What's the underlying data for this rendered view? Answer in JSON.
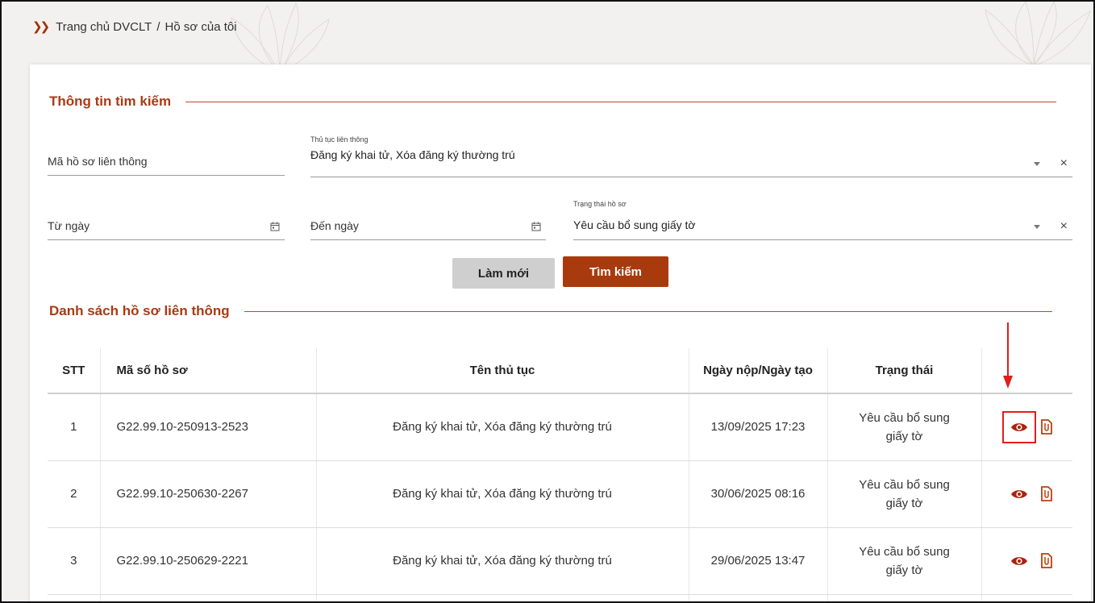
{
  "breadcrumb": {
    "home": "Trang chủ DVCLT",
    "separator": "/",
    "current": "Hồ sơ của tôi"
  },
  "search": {
    "title": "Thông tin tìm kiếm",
    "ma_ho_so": {
      "placeholder": "Mã hồ sơ liên thông"
    },
    "thu_tuc": {
      "label": "Thủ tục liên thông",
      "value": "Đăng ký khai tử, Xóa đăng ký thường trú"
    },
    "tu_ngay": {
      "placeholder": "Từ ngày"
    },
    "den_ngay": {
      "placeholder": "Đến ngày"
    },
    "trang_thai": {
      "label": "Trạng thái hồ sơ",
      "value": "Yêu cầu bổ sung giấy tờ"
    },
    "clear_symbol": "×",
    "reset_label": "Làm mới",
    "search_label": "Tìm kiếm"
  },
  "list": {
    "title": "Danh sách hồ sơ liên thông",
    "headers": {
      "stt": "STT",
      "ma": "Mã số hồ sơ",
      "ten": "Tên thủ tục",
      "ngay": "Ngày nộp/Ngày tạo",
      "trang_thai": "Trạng thái"
    },
    "rows": [
      {
        "stt": "1",
        "ma": "G22.99.10-250913-2523",
        "ten": "Đăng ký khai tử, Xóa đăng ký thường trú",
        "ngay": "13/09/2025 17:23",
        "trang_thai_1": "Yêu cầu bổ sung",
        "trang_thai_2": "giấy tờ"
      },
      {
        "stt": "2",
        "ma": "G22.99.10-250630-2267",
        "ten": "Đăng ký khai tử, Xóa đăng ký thường trú",
        "ngay": "30/06/2025 08:16",
        "trang_thai_1": "Yêu cầu bổ sung",
        "trang_thai_2": "giấy tờ"
      },
      {
        "stt": "3",
        "ma": "G22.99.10-250629-2221",
        "ten": "Đăng ký khai tử, Xóa đăng ký thường trú",
        "ngay": "29/06/2025 13:47",
        "trang_thai_1": "Yêu cầu bổ sung",
        "trang_thai_2": "giấy tờ"
      }
    ]
  },
  "icons": {
    "breadcrumb_chevron": "double-chevron-right-icon",
    "calendar": "calendar-icon",
    "dropdown": "dropdown-arrow-icon",
    "view": "eye-icon",
    "attachment": "document-clip-icon"
  },
  "colors": {
    "accent": "#a83a0e",
    "section_title": "#a83a14",
    "highlight": "#e01e1e",
    "reset_button": "#cfcfcf"
  }
}
